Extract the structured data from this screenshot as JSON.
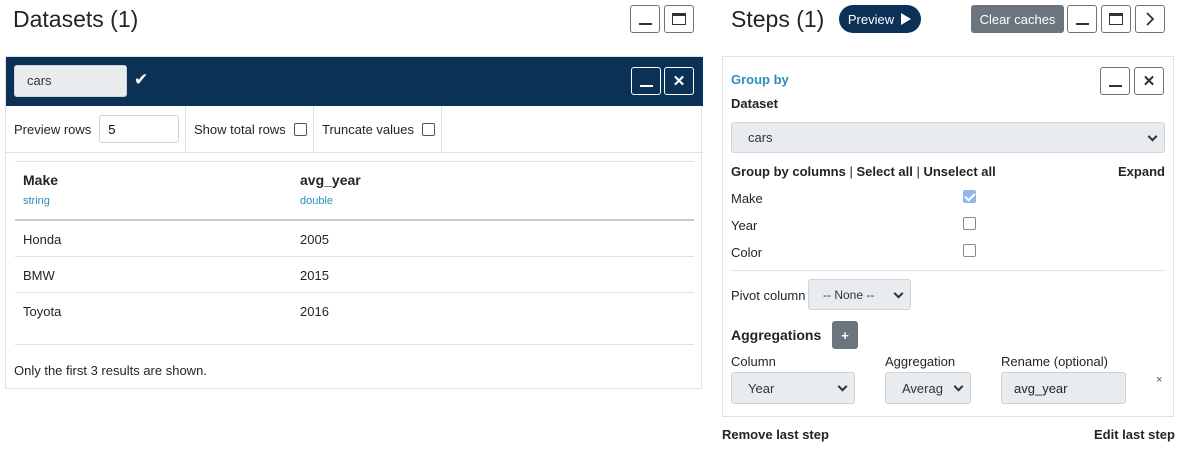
{
  "datasets": {
    "title": "Datasets (1)",
    "card": {
      "name": "cars",
      "options": {
        "preview_rows_label": "Preview rows",
        "preview_rows_value": "5",
        "show_total_rows_label": "Show total rows",
        "truncate_values_label": "Truncate values"
      },
      "columns": [
        {
          "name": "Make",
          "type": "string"
        },
        {
          "name": "avg_year",
          "type": "double"
        }
      ],
      "rows": [
        [
          "Honda",
          "2005"
        ],
        [
          "BMW",
          "2015"
        ],
        [
          "Toyota",
          "2016"
        ]
      ],
      "footer_note": "Only the first 3 results are shown."
    }
  },
  "steps": {
    "title": "Steps (1)",
    "preview_label": "Preview",
    "clear_caches_label": "Clear caches",
    "step": {
      "title": "Group by",
      "dataset_label": "Dataset",
      "dataset_value": "cars",
      "group_by_label": "Group by columns",
      "select_all": "Select all",
      "unselect_all": "Unselect all",
      "expand": "Expand",
      "columns": [
        {
          "name": "Make",
          "checked": true
        },
        {
          "name": "Year",
          "checked": false
        },
        {
          "name": "Color",
          "checked": false
        }
      ],
      "pivot_label": "Pivot column",
      "pivot_value": "-- None --",
      "aggregations_label": "Aggregations",
      "add_label": "+",
      "agg_headers": {
        "column": "Column",
        "aggregation": "Aggregation",
        "rename": "Rename (optional)"
      },
      "agg_row": {
        "column": "Year",
        "aggregation": "Averag",
        "rename": "avg_year",
        "remove": "×"
      }
    },
    "remove_last_step": "Remove last step",
    "edit_last_step": "Edit last step"
  },
  "colors": {
    "navy": "#0b3157",
    "accent": "#2a8fbd",
    "gray_button": "#6c757d"
  }
}
